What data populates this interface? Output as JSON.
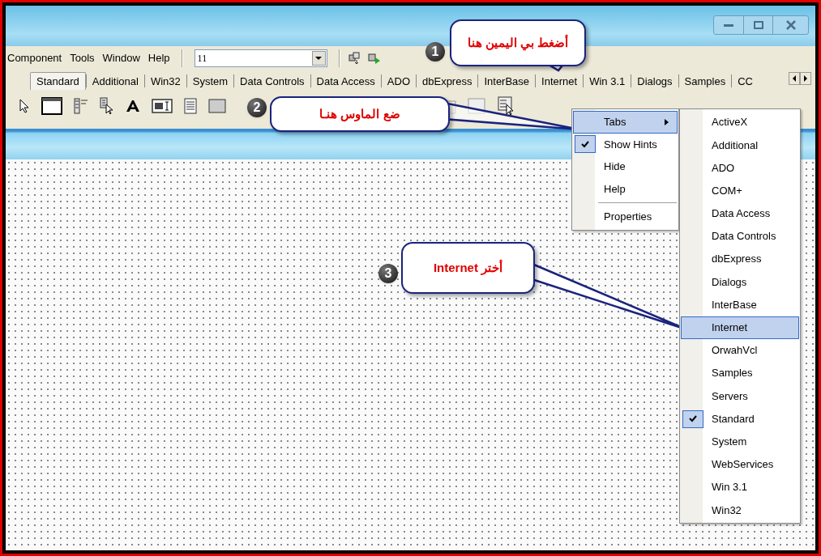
{
  "menu": [
    "Component",
    "Tools",
    "Window",
    "Help"
  ],
  "combo": {
    "value": "11"
  },
  "palette_tabs": [
    {
      "label": "Standard",
      "selected": true
    },
    {
      "label": "Additional",
      "selected": false
    },
    {
      "label": "Win32",
      "selected": false
    },
    {
      "label": "System",
      "selected": false
    },
    {
      "label": "Data Controls",
      "selected": false
    },
    {
      "label": "Data Access",
      "selected": false
    },
    {
      "label": "ADO",
      "selected": false
    },
    {
      "label": "dbExpress",
      "selected": false
    },
    {
      "label": "InterBase",
      "selected": false
    },
    {
      "label": "Internet",
      "selected": false
    },
    {
      "label": "Win 3.1",
      "selected": false
    },
    {
      "label": "Dialogs",
      "selected": false
    },
    {
      "label": "Samples",
      "selected": false
    },
    {
      "label": "CC",
      "selected": false
    }
  ],
  "context_menu": {
    "items": [
      {
        "kind": "submenu",
        "label": "Tabs",
        "selected": true,
        "checked": false
      },
      {
        "kind": "item",
        "label": "Show Hints",
        "selected": false,
        "checked": true
      },
      {
        "kind": "item",
        "label": "Hide",
        "selected": false,
        "checked": false
      },
      {
        "kind": "item",
        "label": "Help",
        "selected": false,
        "checked": false
      },
      {
        "kind": "separator"
      },
      {
        "kind": "item",
        "label": "Properties",
        "selected": false,
        "checked": false
      }
    ]
  },
  "tabs_submenu": {
    "items": [
      {
        "label": "ActiveX",
        "selected": false,
        "checked": false
      },
      {
        "label": "Additional",
        "selected": false,
        "checked": false
      },
      {
        "label": "ADO",
        "selected": false,
        "checked": false
      },
      {
        "label": "COM+",
        "selected": false,
        "checked": false
      },
      {
        "label": "Data Access",
        "selected": false,
        "checked": false
      },
      {
        "label": "Data Controls",
        "selected": false,
        "checked": false
      },
      {
        "label": "dbExpress",
        "selected": false,
        "checked": false
      },
      {
        "label": "Dialogs",
        "selected": false,
        "checked": false
      },
      {
        "label": "InterBase",
        "selected": false,
        "checked": false
      },
      {
        "label": "Internet",
        "selected": true,
        "checked": false
      },
      {
        "label": "OrwahVcl",
        "selected": false,
        "checked": false
      },
      {
        "label": "Samples",
        "selected": false,
        "checked": false
      },
      {
        "label": "Servers",
        "selected": false,
        "checked": false
      },
      {
        "label": "Standard",
        "selected": false,
        "checked": true
      },
      {
        "label": "System",
        "selected": false,
        "checked": false
      },
      {
        "label": "WebServices",
        "selected": false,
        "checked": false
      },
      {
        "label": "Win 3.1",
        "selected": false,
        "checked": false
      },
      {
        "label": "Win32",
        "selected": false,
        "checked": false
      }
    ]
  },
  "callouts": [
    {
      "number": "1",
      "text": "أضغط بي اليمين هنا"
    },
    {
      "number": "2",
      "text": "ضع الماوس هنـا"
    },
    {
      "number": "3",
      "text": "أختر Internet"
    }
  ]
}
